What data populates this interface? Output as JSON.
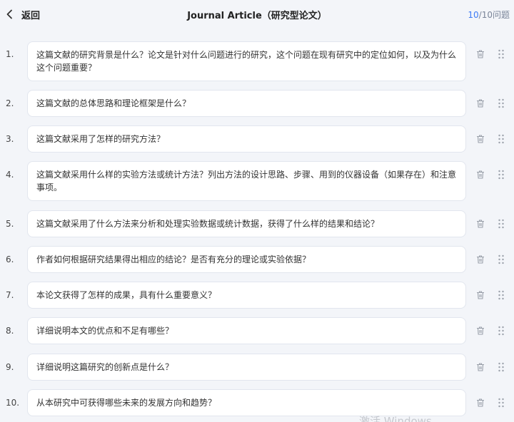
{
  "header": {
    "back_label": "返回",
    "title": "Journal Article（研究型论文）",
    "counter_current": "10",
    "counter_rest": "/10问题"
  },
  "questions": [
    {
      "num": "1.",
      "text": "这篇文献的研究背景是什么？论文是针对什么问题进行的研究，这个问题在现有研究中的定位如何，以及为什么这个问题重要？"
    },
    {
      "num": "2.",
      "text": "这篇文献的总体思路和理论框架是什么？"
    },
    {
      "num": "3.",
      "text": "这篇文献采用了怎样的研究方法？"
    },
    {
      "num": "4.",
      "text": "这篇文献采用什么样的实验方法或统计方法？列出方法的设计思路、步骤、用到的仪器设备（如果存在）和注意事项。"
    },
    {
      "num": "5.",
      "text": "这篇文献采用了什么方法来分析和处理实验数据或统计数据，获得了什么样的结果和结论？"
    },
    {
      "num": "6.",
      "text": "作者如何根据研究结果得出相应的结论？是否有充分的理论或实验依据？"
    },
    {
      "num": "7.",
      "text": "本论文获得了怎样的成果，具有什么重要意义？"
    },
    {
      "num": "8.",
      "text": "详细说明本文的优点和不足有哪些？"
    },
    {
      "num": "9.",
      "text": "详细说明这篇研究的创新点是什么？"
    },
    {
      "num": "10.",
      "text": "从本研究中可获得哪些未来的发展方向和趋势？"
    }
  ],
  "icons": {
    "back": "chevron-left-icon",
    "delete": "trash-icon",
    "drag": "drag-handle-icon"
  },
  "colors": {
    "accent": "#3d7bf5",
    "background": "#f3f5f9"
  },
  "watermark": "激活 Windows"
}
